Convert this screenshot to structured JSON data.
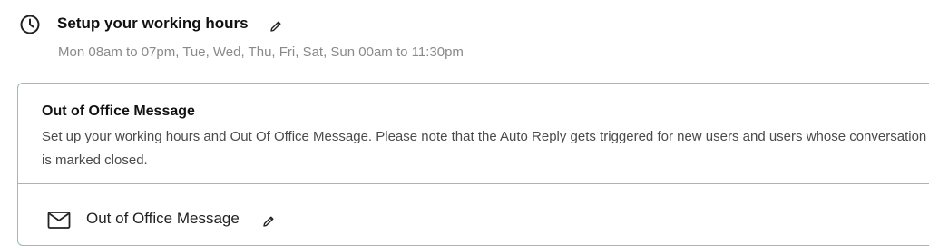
{
  "working_hours": {
    "icon": "clock-icon",
    "title": "Setup your working hours",
    "edit_icon": "pencil-icon",
    "schedule": "Mon 08am to 07pm, Tue, Wed, Thu, Fri, Sat, Sun 00am to 11:30pm"
  },
  "out_of_office": {
    "title": "Out of Office Message",
    "description": "Set up your working hours and Out Of Office Message. Please note that the Auto Reply gets triggered for new users and users whose conversation is marked closed.",
    "message_row": {
      "icon": "mail-icon",
      "label": "Out of Office Message",
      "edit_icon": "pencil-icon"
    },
    "border_color": "#8fc5a6"
  }
}
